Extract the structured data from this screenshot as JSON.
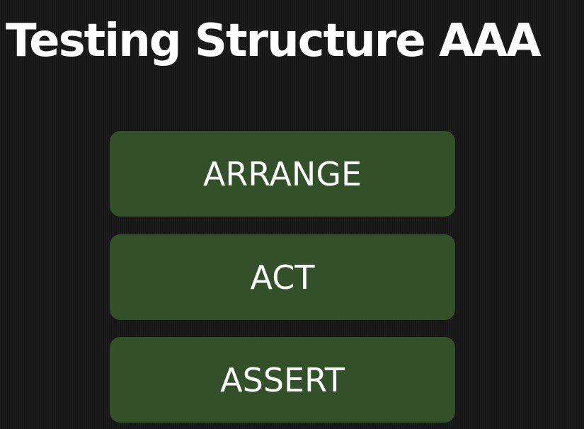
{
  "title": "Testing Structure AAA",
  "steps": [
    {
      "label": "ARRANGE"
    },
    {
      "label": "ACT"
    },
    {
      "label": "ASSERT"
    }
  ],
  "colors": {
    "background": "#1b1b1b",
    "box_fill": "#335128",
    "text": "#ffffff"
  }
}
